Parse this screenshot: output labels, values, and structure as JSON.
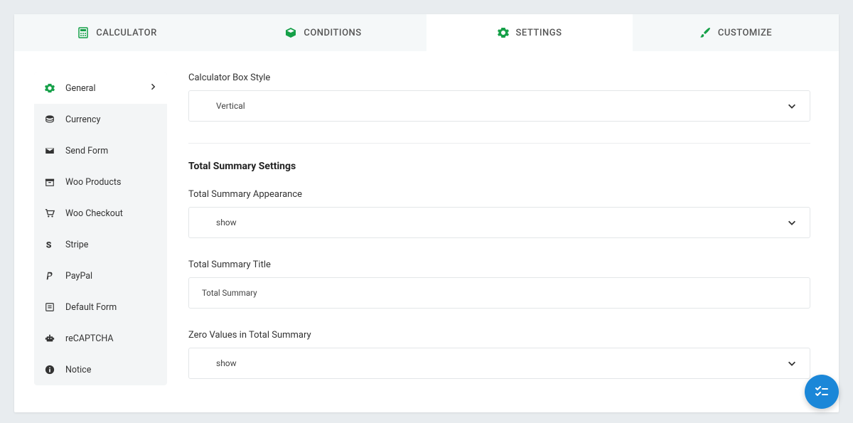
{
  "tabs": [
    {
      "label": "CALCULATOR",
      "icon": "calculator-icon"
    },
    {
      "label": "CONDITIONS",
      "icon": "box-icon"
    },
    {
      "label": "SETTINGS",
      "icon": "gear-icon"
    },
    {
      "label": "CUSTOMIZE",
      "icon": "brush-icon"
    }
  ],
  "active_tab": 2,
  "sidebar": {
    "items": [
      {
        "label": "General",
        "icon": "gear-icon",
        "active": true
      },
      {
        "label": "Currency",
        "icon": "coins-icon"
      },
      {
        "label": "Send Form",
        "icon": "envelope-icon"
      },
      {
        "label": "Woo Products",
        "icon": "archive-icon"
      },
      {
        "label": "Woo Checkout",
        "icon": "cart-icon"
      },
      {
        "label": "Stripe",
        "icon": "stripe-icon"
      },
      {
        "label": "PayPal",
        "icon": "paypal-icon"
      },
      {
        "label": "Default Form",
        "icon": "form-icon"
      },
      {
        "label": "reCAPTCHA",
        "icon": "robot-icon"
      },
      {
        "label": "Notice",
        "icon": "info-icon"
      }
    ]
  },
  "main": {
    "box_style_label": "Calculator Box Style",
    "box_style_value": "Vertical",
    "total_settings_heading": "Total Summary Settings",
    "appearance_label": "Total Summary Appearance",
    "appearance_value": "show",
    "title_label": "Total Summary Title",
    "title_value": "Total Summary",
    "zero_label": "Zero Values in Total Summary",
    "zero_value": "show"
  },
  "colors": {
    "accent": "#15a048",
    "fab": "#1b87d8"
  }
}
